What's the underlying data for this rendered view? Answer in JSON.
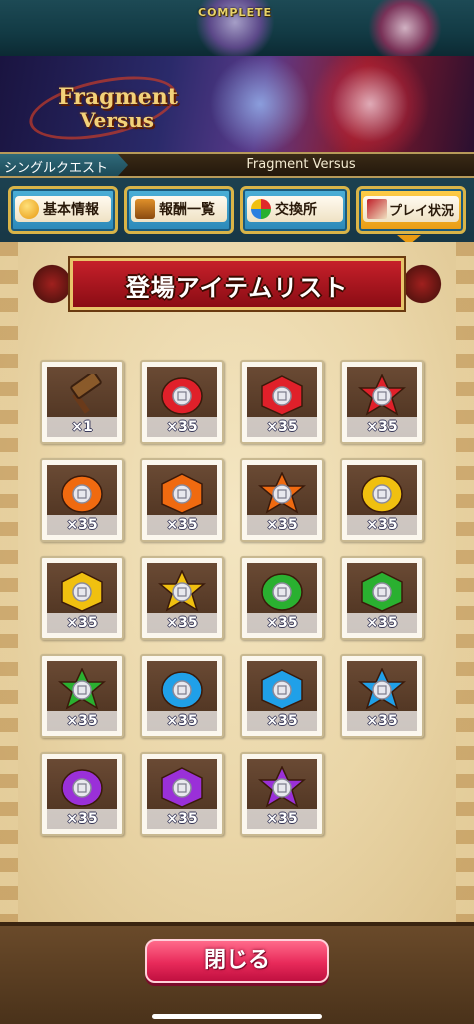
{
  "top": {
    "complete_label": "COMPLETE"
  },
  "banner": {
    "logo_line1": "Fragment",
    "logo_line2": "Versus"
  },
  "breadcrumb": {
    "quest_type": "シングルクエスト",
    "title": "Fragment Versus"
  },
  "tabs": [
    {
      "label": "基本情報",
      "icon": "question-icon",
      "active": false
    },
    {
      "label": "報酬一覧",
      "icon": "treasure-chest-icon",
      "active": false
    },
    {
      "label": "交換所",
      "icon": "exchange-icon",
      "active": false
    },
    {
      "label": "プレイ状況",
      "icon": "flag-icon",
      "active": true
    }
  ],
  "heading": {
    "title": "登場アイテムリスト"
  },
  "items": [
    {
      "qty": "×1",
      "kind": "hammer",
      "color": "#8a5a2a"
    },
    {
      "qty": "×35",
      "kind": "round",
      "color": "#e0202a"
    },
    {
      "qty": "×35",
      "kind": "hex",
      "color": "#e0202a"
    },
    {
      "qty": "×35",
      "kind": "star",
      "color": "#e0202a"
    },
    {
      "qty": "×35",
      "kind": "round",
      "color": "#f06a10"
    },
    {
      "qty": "×35",
      "kind": "hex",
      "color": "#f06a10"
    },
    {
      "qty": "×35",
      "kind": "star",
      "color": "#f06a10"
    },
    {
      "qty": "×35",
      "kind": "round",
      "color": "#f0c010"
    },
    {
      "qty": "×35",
      "kind": "hex",
      "color": "#f0c010"
    },
    {
      "qty": "×35",
      "kind": "star",
      "color": "#f0c010"
    },
    {
      "qty": "×35",
      "kind": "round",
      "color": "#2ab030"
    },
    {
      "qty": "×35",
      "kind": "hex",
      "color": "#2ab030"
    },
    {
      "qty": "×35",
      "kind": "star",
      "color": "#2ab030"
    },
    {
      "qty": "×35",
      "kind": "round",
      "color": "#20a0e8"
    },
    {
      "qty": "×35",
      "kind": "hex",
      "color": "#20a0e8"
    },
    {
      "qty": "×35",
      "kind": "star",
      "color": "#20a0e8"
    },
    {
      "qty": "×35",
      "kind": "round",
      "color": "#9a30d8"
    },
    {
      "qty": "×35",
      "kind": "hex",
      "color": "#9a30d8"
    },
    {
      "qty": "×35",
      "kind": "star",
      "color": "#9a30d8"
    }
  ],
  "footer": {
    "close_label": "閉じる"
  }
}
